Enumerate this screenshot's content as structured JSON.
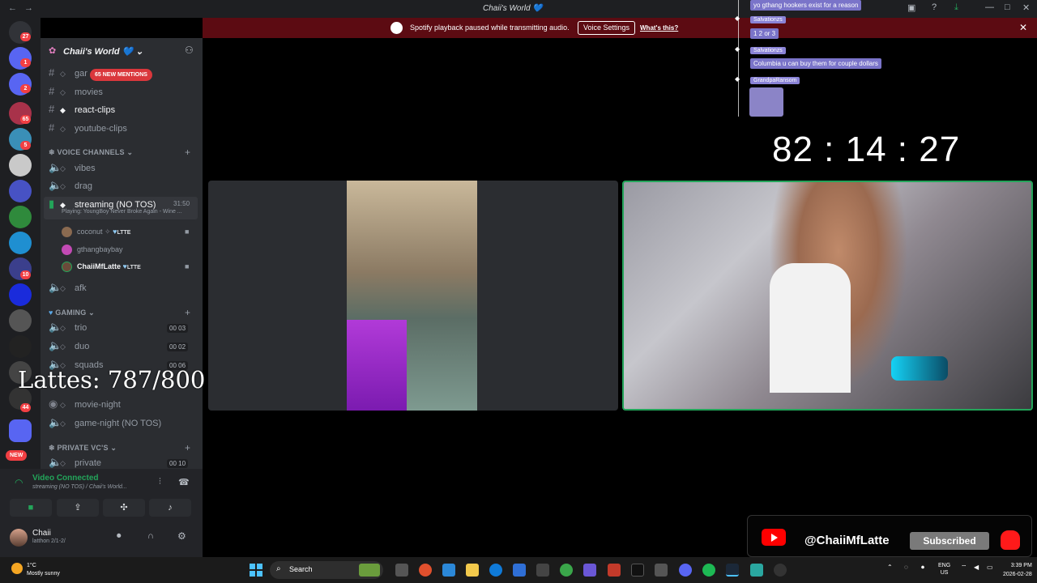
{
  "titlebar": {
    "title": "Chaii's World 💙",
    "back": "←",
    "forward": "→"
  },
  "banner": {
    "text": "Spotify playback paused while transmitting audio.",
    "button": "Voice Settings",
    "link": "What's this?",
    "close": "✕"
  },
  "servers": {
    "badges": [
      "27",
      "1",
      "2",
      "65",
      "5",
      "10",
      "44"
    ]
  },
  "guild": {
    "name": "Chaii's World 💙",
    "chevron": "⌄"
  },
  "mentions_pill": "65 NEW MENTIONS",
  "text_channels": [
    {
      "name": "gar"
    },
    {
      "name": "movies"
    },
    {
      "name": "react-clips"
    },
    {
      "name": "youtube-clips"
    }
  ],
  "voice_category": "VOICE CHANNELS",
  "voice_channels": [
    {
      "name": "vibes"
    },
    {
      "name": "drag"
    }
  ],
  "streaming_channel": {
    "name": "streaming (NO TOS)",
    "timer": "31:50",
    "activity": "Playing: YoungBoy Never Broke Again - Wine ..."
  },
  "voice_users": [
    {
      "name": "coconut",
      "tag": "LTTE"
    },
    {
      "name": "gthangbaybay",
      "tag": ""
    },
    {
      "name": "ChaiiMfLatte",
      "tag": "LTTE"
    }
  ],
  "afk_channel": "afk",
  "gaming_category": "GAMING",
  "gaming_channels": [
    {
      "name": "trio",
      "count_a": "00",
      "count_b": "03"
    },
    {
      "name": "duo",
      "count_a": "00",
      "count_b": "02"
    },
    {
      "name": "squads",
      "count_a": "00",
      "count_b": "06"
    }
  ],
  "event_channels": [
    {
      "name": "movie-night"
    },
    {
      "name": "game-night (NO TOS)"
    }
  ],
  "private_category": "PRIVATE VC'S",
  "private_channels": [
    {
      "name": "private",
      "count_a": "00",
      "count_b": "10"
    }
  ],
  "lattes_overlay": "Lattes: 787/800",
  "new_badge": "NEW",
  "voice_panel": {
    "status": "Video Connected",
    "subtitle": "streaming (NO TOS) / Chaii's World...",
    "username": "Chaii",
    "user_sub": "latthon 2/1-2/"
  },
  "chat": [
    {
      "type": "msg",
      "text": "yo gthang hookers exist for a reason"
    },
    {
      "type": "name",
      "text": "Salvationzs"
    },
    {
      "type": "msg",
      "text": "1 2 or 3"
    },
    {
      "type": "name",
      "text": "Salvationzs"
    },
    {
      "type": "msg",
      "text": "Columbia u can buy them for couple dollars"
    },
    {
      "type": "name",
      "text": "GrandpaRansom"
    }
  ],
  "timer": "82 : 14 : 27",
  "youtube": {
    "handle": "@ChaiiMfLatte",
    "button": "Subscribed"
  },
  "taskbar": {
    "weather_temp": "1°C",
    "weather_text": "Mostly sunny",
    "search": "Search",
    "lang": "ENG",
    "region": "US",
    "time": "3:39 PM",
    "date": "2026-02-28"
  },
  "colors": {
    "accent_green": "#23a55a",
    "banner_red": "#5c0b12",
    "chat_purple": "#7a74c9",
    "youtube_red": "#ff0000"
  }
}
